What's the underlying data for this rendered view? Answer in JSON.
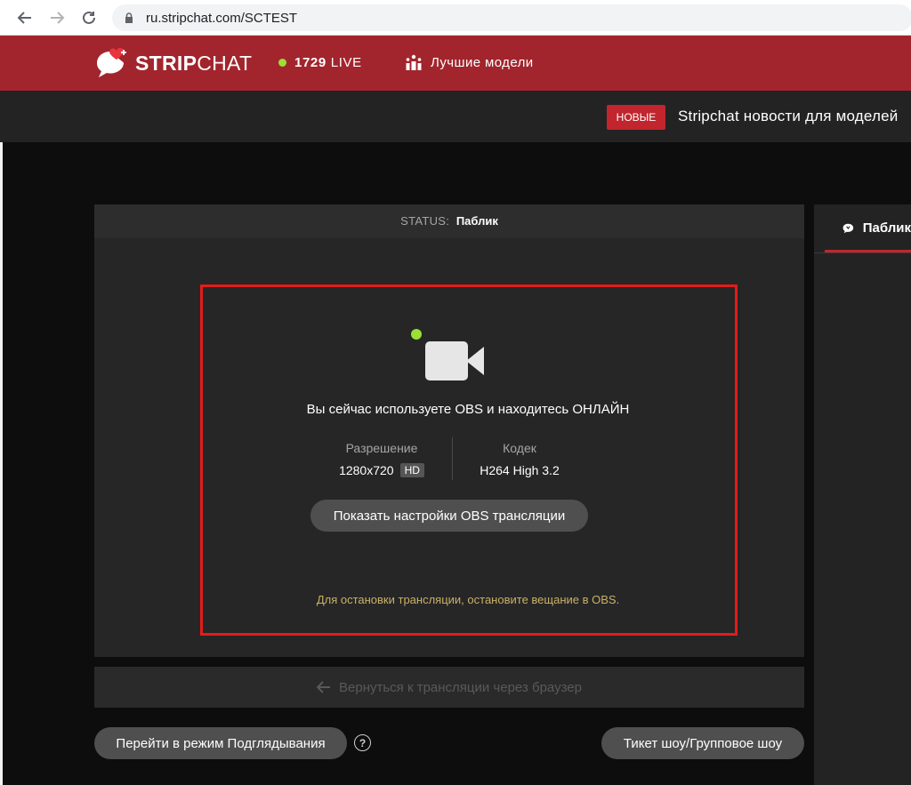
{
  "browser": {
    "url": "ru.stripchat.com/SCTEST",
    "icons": [
      "back-arrow-icon",
      "forward-arrow-icon",
      "reload-icon",
      "lock-icon"
    ]
  },
  "header": {
    "logo_strip": "STRIP",
    "logo_chat": "CHAT",
    "live_count": "1729",
    "live_label": "LIVE",
    "top_models": "Лучшие модели",
    "brand_color": "#a2252d",
    "live_dot_color": "#9be034"
  },
  "news": {
    "badge": "НОВЫЕ",
    "text": "Stripchat новости для моделей"
  },
  "status": {
    "label": "STATUS:",
    "value": "Паблик"
  },
  "broadcast": {
    "online_message": "Вы сейчас используете OBS и находитесь ОНЛАЙН",
    "resolution_label": "Разрешение",
    "resolution_value": "1280x720",
    "hd_badge": "HD",
    "codec_label": "Кодек",
    "codec_value": "H264 High 3.2",
    "settings_button": "Показать настройки OBS трансляции",
    "stop_hint": "Для остановки трансляции, остановите вещание в OBS.",
    "highlight_color": "#e51b1b"
  },
  "actions": {
    "back_to_browser": "Вернуться к трансляции через браузер",
    "peek_mode": "Перейти в режим Подглядывания",
    "help": "?",
    "ticket_show": "Тикет шоу/Групповое шоу"
  },
  "chat": {
    "tab_label": "Паблик"
  }
}
